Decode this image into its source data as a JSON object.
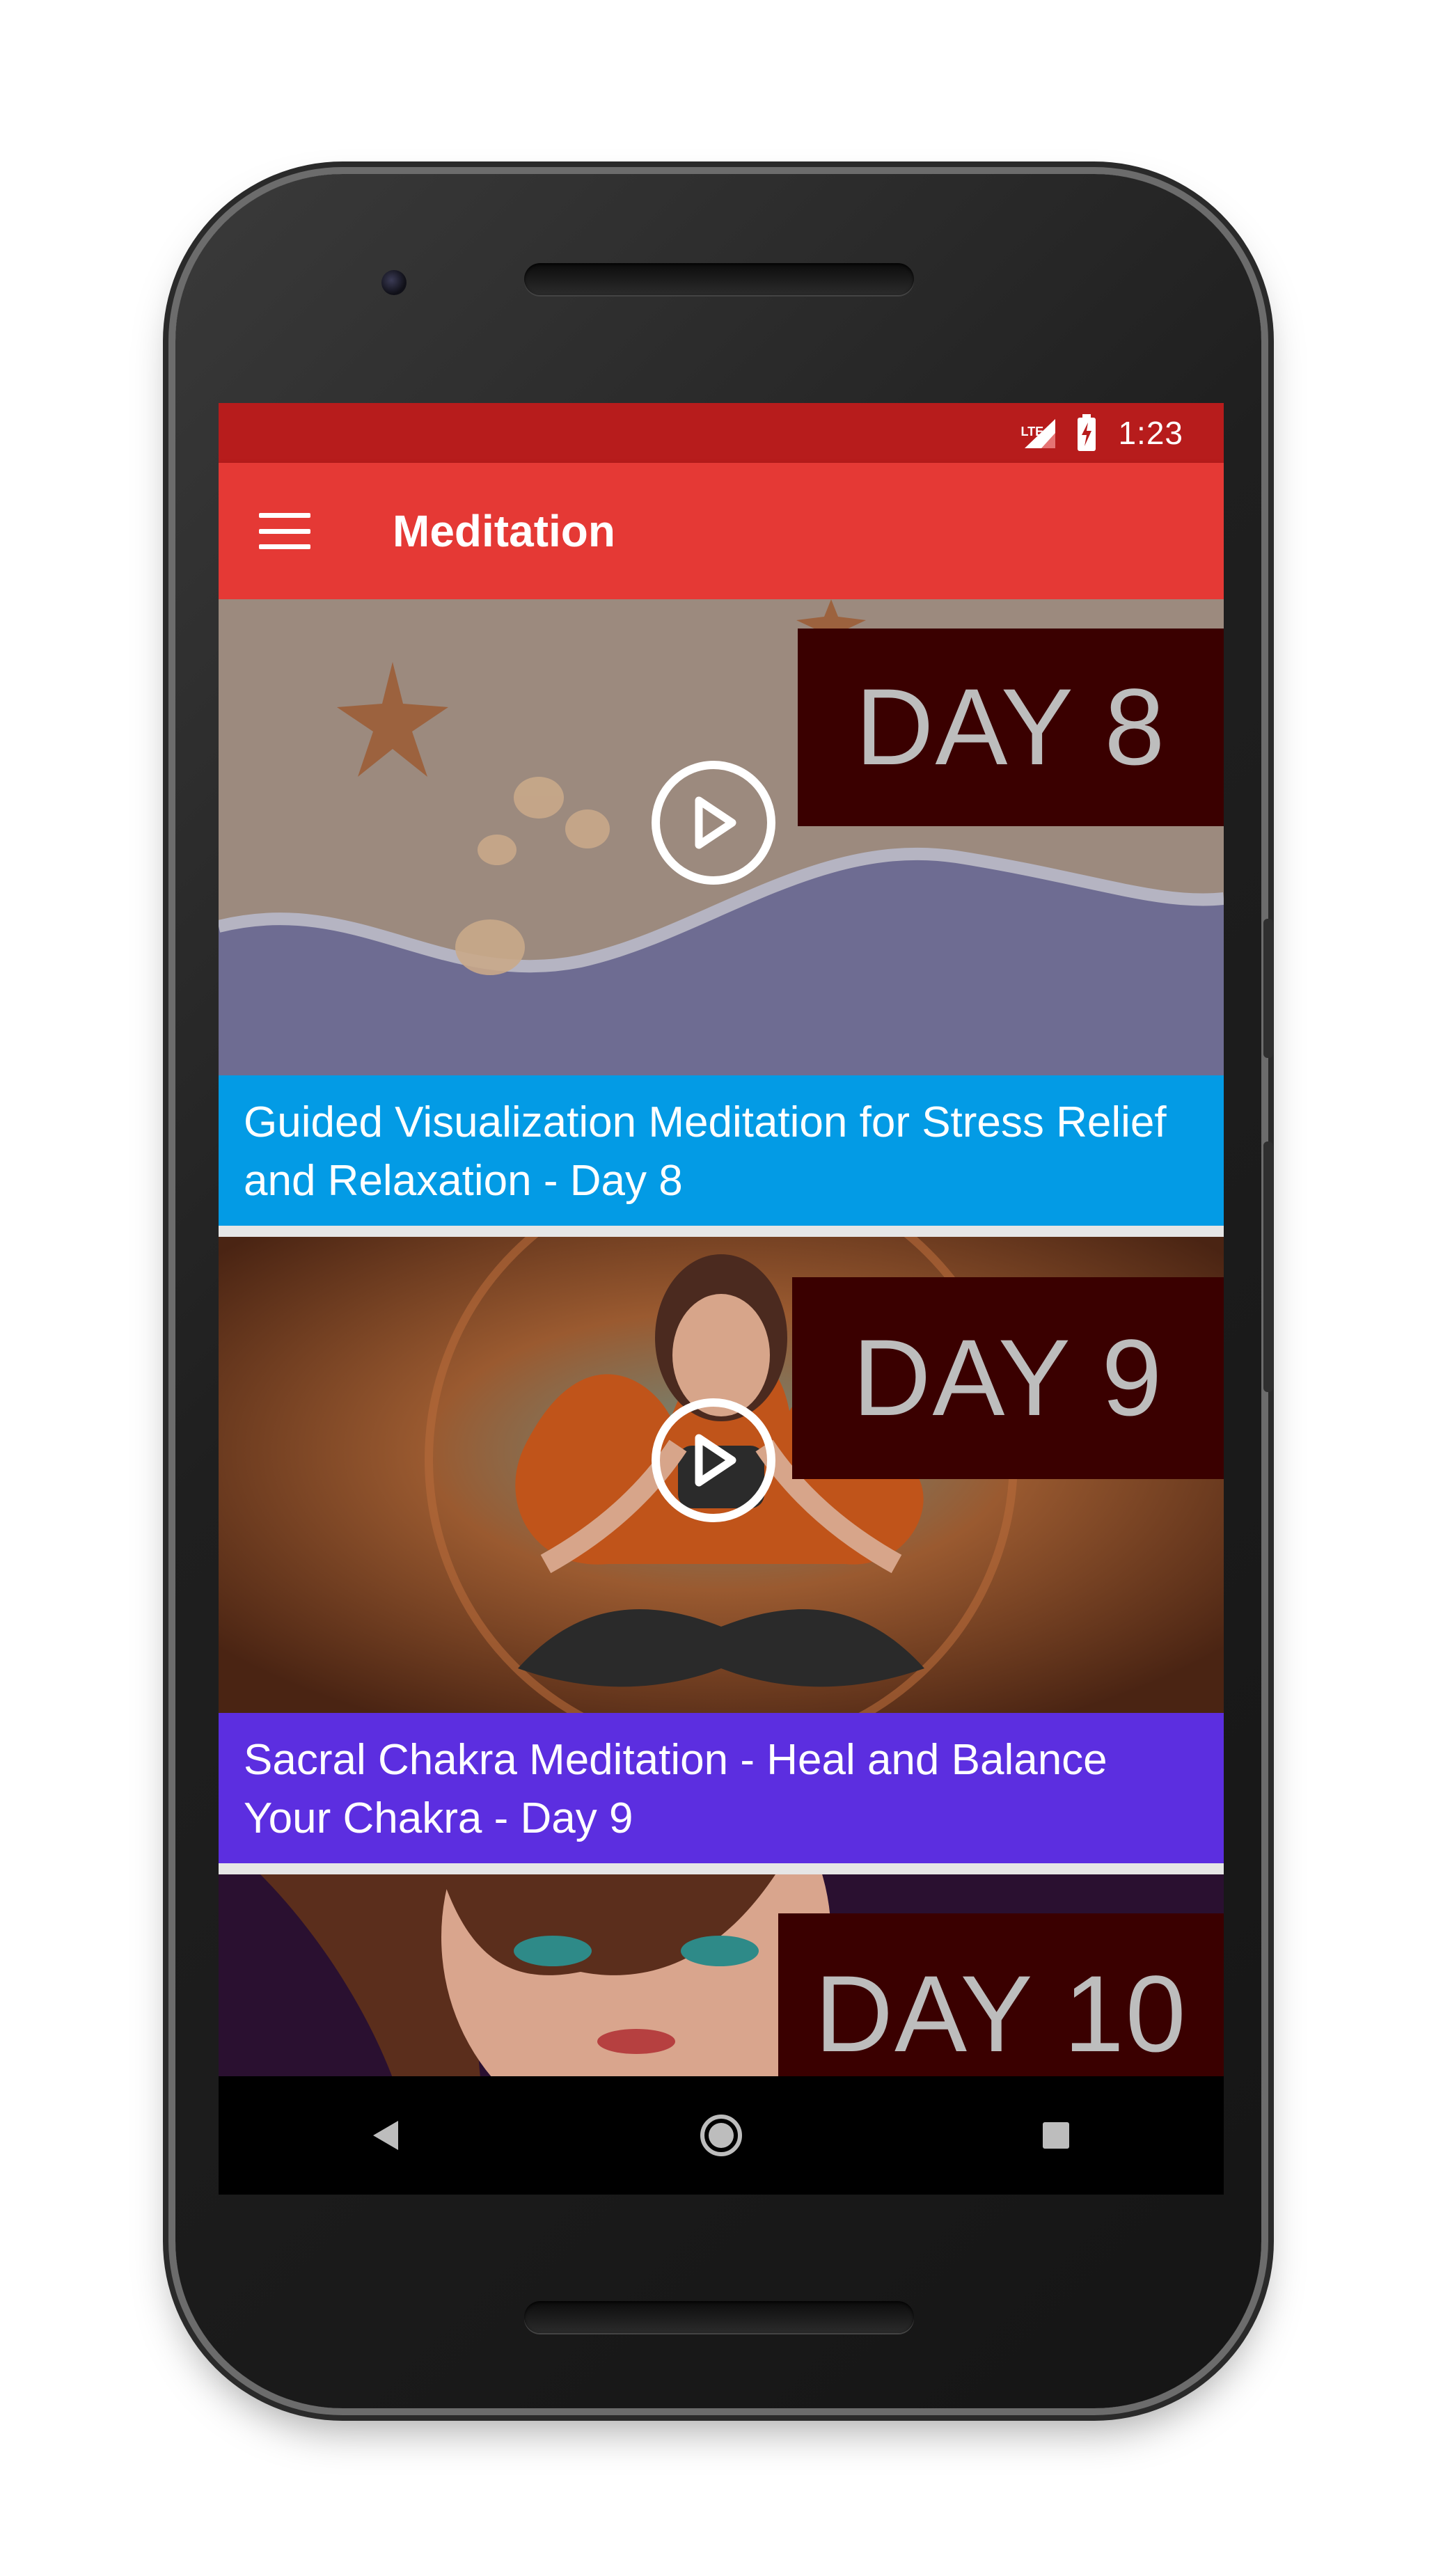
{
  "statusbar": {
    "network": "LTE",
    "time": "1:23"
  },
  "appbar": {
    "title": "Meditation"
  },
  "videos": [
    {
      "day_label": "DAY 8",
      "title": "Guided Visualization Meditation for Stress Relief and Relaxation - Day 8",
      "caption_color": "#039be5"
    },
    {
      "day_label": "DAY 9",
      "title": "Sacral Chakra Meditation - Heal and Balance Your Chakra - Day 9",
      "caption_color": "#5c2ee0"
    },
    {
      "day_label": "DAY 10"
    }
  ],
  "colors": {
    "statusbar": "#b71c1c",
    "appbar": "#e53935",
    "navbar": "#000000"
  },
  "icons": {
    "menu": "hamburger-icon",
    "play": "play-circle-icon",
    "back": "back-triangle-icon",
    "home": "home-circle-icon",
    "recents": "recents-square-icon"
  }
}
